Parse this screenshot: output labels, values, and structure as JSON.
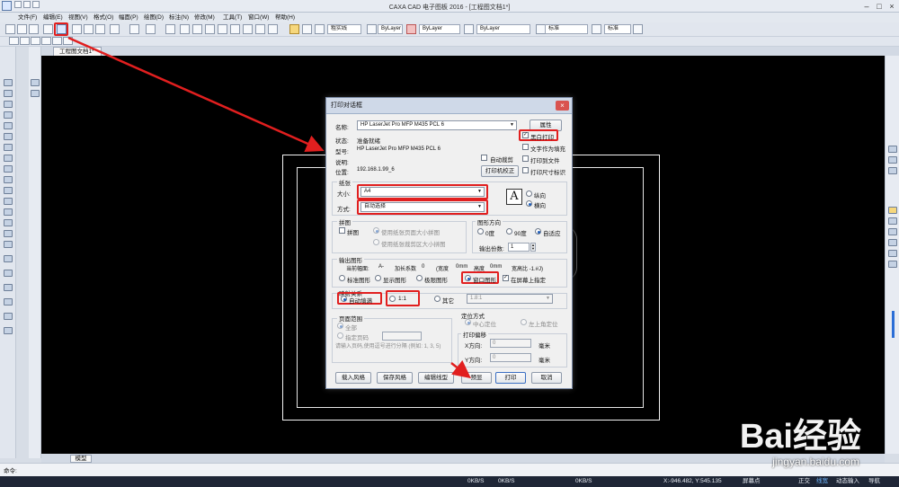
{
  "window": {
    "title": "CAXA CAD 电子图板 2016 - [工程图文档1*]"
  },
  "menu": [
    "文件(F)",
    "编辑(E)",
    "视图(V)",
    "格式(O)",
    "幅面(P)",
    "绘图(D)",
    "标注(N)",
    "修改(M)",
    "工具(T)",
    "窗口(W)",
    "帮助(H)"
  ],
  "toolbar": {
    "linetype": "粗实线",
    "layer_value": "ByLayer",
    "color_value": "ByLayer",
    "lineweight_value": "ByLayer",
    "style1": "标准",
    "style2": "标准"
  },
  "document_tab": "工程图文档1*",
  "model_tab": "模型",
  "dialog": {
    "title": "打印对话框",
    "printer_name_label": "名称:",
    "printer_name": "HP LaserJet Pro MFP M435 PCL 6",
    "properties_button": "属性",
    "status_label": "状态:",
    "status_value": "准备就绪",
    "type_label": "型号:",
    "type_value": "HP LaserJet Pro MFP M435 PCL 6",
    "desc_label": "说明:",
    "location_label": "位置:",
    "location_value": "192.168.1.99_6",
    "auto_crop": "自动裁剪",
    "calibrate_button": "打印机校正",
    "bw_print": "黑白打印",
    "text_fill": "文字作为填充",
    "print_to_file": "打印到文件",
    "print_size_mark": "打印尺寸标识",
    "paper_group": "纸张",
    "paper_size_label": "大小:",
    "paper_size": "A4",
    "paper_source_label": "方式:",
    "paper_source": "自动选择",
    "orientation_portrait": "纵向",
    "orientation_landscape": "横向",
    "tiling_group": "拼图",
    "tiling": "拼图",
    "tile_opt1": "使用纸张页面大小拼图",
    "tile_opt2": "使用纸张裁剪区大小拼图",
    "rotate_group": "图形方向",
    "rot_0": "0度",
    "rot_90": "90度",
    "rot_auto": "自适应",
    "copies_label": "输出份数:",
    "copies": "1",
    "output_group": "输出图形",
    "current_sheet_label": "当前幅面:",
    "current_sheet": "A-",
    "extend_label": "加长系数",
    "extend_value": "0",
    "width_label": "(宽度",
    "width_value": "0mm",
    "height_label": "高度",
    "height_value": "0mm",
    "ratio_label": "宽高比 -1.#J)",
    "out_standard": "标准图形",
    "out_display": "显示图形",
    "out_extents": "极限图形",
    "out_window": "窗口图形",
    "onscreen_specify": "在屏幕上指定",
    "map_group": "映射关系",
    "auto_fill": "自动填满",
    "scale_11": "1:1",
    "other": "其它",
    "other_value": "1.8:1",
    "page_range_group": "页面范围",
    "all_pages": "全部",
    "specify_pages": "指定页码",
    "page_hint": "请输入页码,使用逗号进行分隔 (例如: 1, 3, 5)",
    "position_group": "定位方式",
    "center": "中心定位",
    "top_left": "左上角定位",
    "offset_group": "打印偏移",
    "x_label": "X方向:",
    "x_value": "0",
    "y_label": "Y方向:",
    "y_value": "0",
    "unit_mm": "毫米",
    "load_style": "载入风格",
    "save_style": "保存风格",
    "edit_linetype": "编辑线型",
    "preview": "预显",
    "print": "打印",
    "cancel": "取消"
  },
  "status": {
    "command_prompt": "命令:",
    "net1": "0KB/S",
    "net2": "0KB/S",
    "net3": "0KB/S",
    "coords": "X:-946.482, Y:545.135",
    "snap": "屏幕点",
    "ortho": "正交",
    "lineweight": "线宽",
    "dynamic_input": "动态输入",
    "navigate": "导航"
  },
  "watermark": {
    "main": "Bai经验",
    "sub": "jingyan.baidu.com"
  },
  "colors": {
    "highlight": "#e11f1f",
    "canvas": "#000000",
    "dialog_bg": "#f0f0f0",
    "statusbar": "#1f2636"
  }
}
